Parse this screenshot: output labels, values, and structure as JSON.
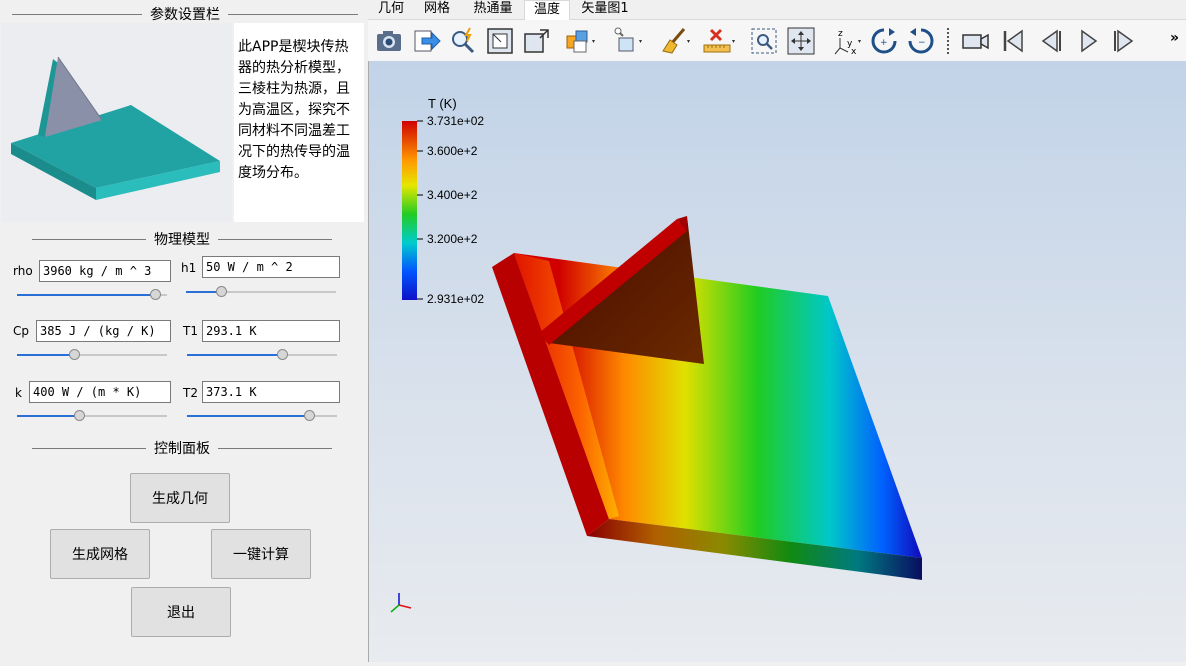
{
  "left_panel": {
    "param_title": "参数设置栏",
    "description": "此APP是楔块传热器的热分析模型，三棱柱为热源，且为高温区，探究不同材料不同温差工况下的热传导的温度场分布。",
    "physics_title": "物理模型",
    "params": [
      {
        "label": "rho",
        "value": "3960 kg / m ^ 3",
        "slider": 0.92
      },
      {
        "label": "h1",
        "value": "50 W / m ^ 2",
        "slider": 0.23
      },
      {
        "label": "Cp",
        "value": "385 J / (kg / K)",
        "slider": 0.38
      },
      {
        "label": "T1",
        "value": "293.1 K",
        "slider": 0.63
      },
      {
        "label": "k",
        "value": "400 W / (m * K)",
        "slider": 0.41
      },
      {
        "label": "T2",
        "value": "373.1 K",
        "slider": 0.81
      }
    ],
    "control_title": "控制面板",
    "buttons": {
      "geometry": "生成几何",
      "mesh": "生成网格",
      "compute": "一键计算",
      "exit": "退出"
    }
  },
  "tabs": [
    {
      "label": "几何",
      "active": false
    },
    {
      "label": "网格",
      "active": false
    },
    {
      "label": "热通量",
      "active": false
    },
    {
      "label": "温度",
      "active": true
    },
    {
      "label": "矢量图1",
      "active": false
    }
  ],
  "toolbar": {
    "icons": [
      "camera-icon",
      "export-icon",
      "zoom-icon",
      "zoom-box-icon",
      "zoom-extents-icon",
      "scene-light-icon",
      "light-icon",
      "clear-icon",
      "delete-icon",
      "zoom-selection-icon",
      "pan-icon",
      "axis-icon",
      "rotate-cw-icon",
      "rotate-ccw-icon",
      "record-icon",
      "first-frame-icon",
      "prev-frame-icon",
      "play-icon",
      "last-frame-icon"
    ],
    "overflow": "»"
  },
  "colorbar": {
    "title": "T (K)",
    "ticks": [
      "3.731e+02",
      "3.600e+2",
      "3.400e+2",
      "3.200e+2",
      "2.931e+02"
    ],
    "colors": [
      "#d00000",
      "#ff9900",
      "#e6e600",
      "#22cc22",
      "#00cccc",
      "#0055ff",
      "#1010c8"
    ]
  },
  "axes": {
    "x": "x",
    "y": "y",
    "z": "z"
  }
}
